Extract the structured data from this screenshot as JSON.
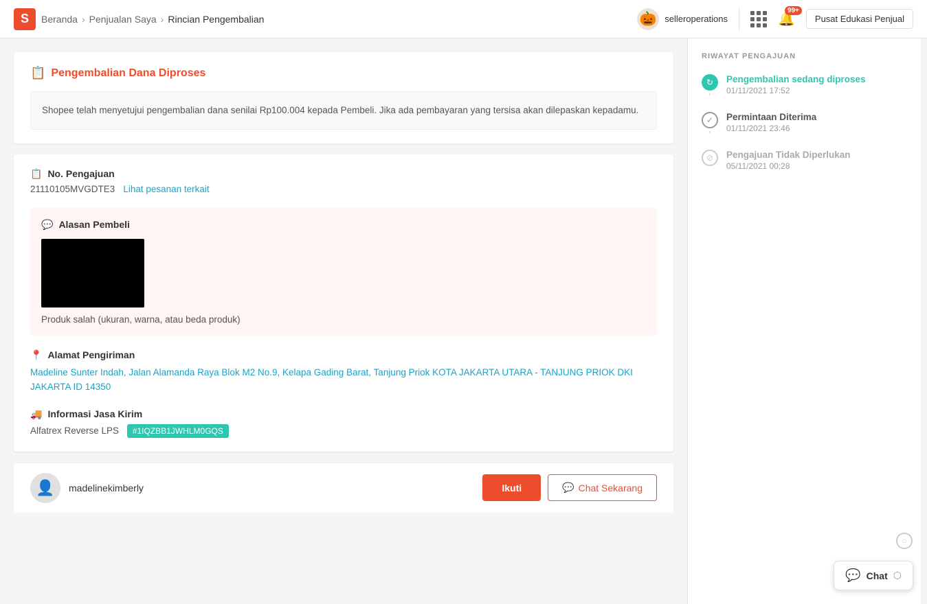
{
  "header": {
    "logo": "S",
    "breadcrumb": {
      "home": "Beranda",
      "penjualan": "Penjualan Saya",
      "current": "Rincian Pengembalian"
    },
    "seller": {
      "name": "selleroperations"
    },
    "notification_badge": "99+",
    "edu_button": "Pusat Edukasi Penjual"
  },
  "dana_section": {
    "title": "Pengembalian Dana Diproses",
    "info_text": "Shopee telah menyetujui pengembalian dana senilai Rp100.004 kepada Pembeli. Jika ada pembayaran yang tersisa akan dilepaskan kepadamu."
  },
  "detail_section": {
    "no_pengajuan_label": "No. Pengajuan",
    "no_pengajuan_value": "21110105MVGDTE3",
    "lihat_pesanan": "Lihat pesanan terkait",
    "alasan_label": "Alasan Pembeli",
    "alasan_text": "Produk salah (ukuran, warna, atau beda produk)",
    "alamat_label": "Alamat Pengiriman",
    "alamat_value": "Madeline Sunter Indah, Jalan Alamanda Raya Blok M2 No.9, Kelapa Gading Barat, Tanjung Priok KOTA JAKARTA UTARA - TANJUNG PRIOK DKI JAKARTA ID 14350",
    "jasa_kirim_label": "Informasi Jasa Kirim",
    "jasa_kirim_name": "Alfatrex Reverse LPS",
    "tracking_number": "#1IQZBB1JWHLM0GQS"
  },
  "bottom_bar": {
    "username": "madelinekimberly",
    "follow_label": "Ikuti",
    "chat_label": "Chat Sekarang"
  },
  "sidebar": {
    "title": "RIWAYAT PENGAJUAN",
    "timeline": [
      {
        "label": "Pengembalian sedang diproses",
        "date": "01/11/2021 17:52",
        "status": "active"
      },
      {
        "label": "Permintaan Diterima",
        "date": "01/11/2021 23:46",
        "status": "done"
      },
      {
        "label": "Pengajuan Tidak Diperlukan",
        "date": "05/11/2021 00:28",
        "status": "cancelled"
      }
    ]
  },
  "chat_float": {
    "label": "Chat"
  }
}
